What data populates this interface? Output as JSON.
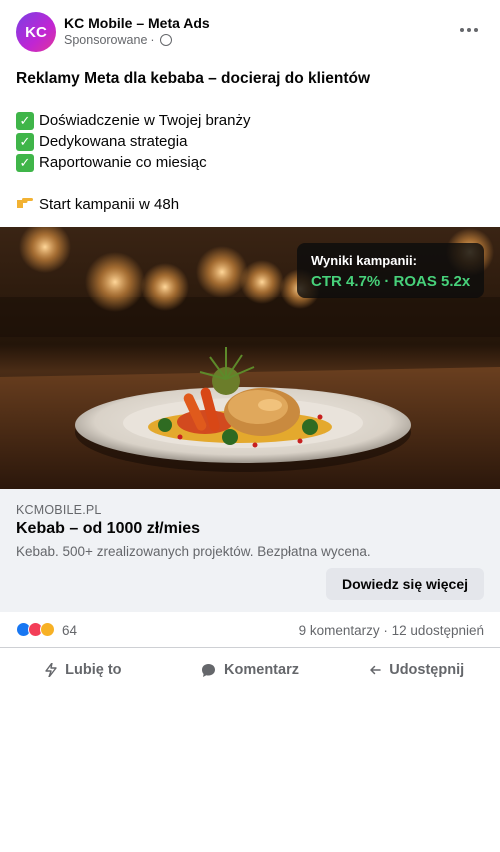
{
  "post": {
    "avatar_initials": "KC",
    "page_name": "KC Mobile – Meta Ads",
    "sponsored_label": "Sponsorowane",
    "separator": "·",
    "headline": "Reklamy Meta dla kebaba – docieraj do klientów",
    "bullets": [
      "Doświadczenie w Twojej branży",
      "Dedykowana strategia",
      "Raportowanie co miesiąc"
    ],
    "check_glyph": "✓",
    "cta_line": "Start kampanii w 48h"
  },
  "image": {
    "stats_title": "Wyniki kampanii:",
    "stats_values": "CTR 4.7% · ROAS 5.2x"
  },
  "link": {
    "domain": "KCMOBILE.PL",
    "title": "Kebab – od 1000 zł/mies",
    "description": "Kebab. 500+ zrealizowanych projektów. Bezpłatna wycena.",
    "button_label": "Dowiedz się więcej"
  },
  "reactions": {
    "count": "64",
    "engagement": "9 komentarzy · 12 udostępnień"
  },
  "actions": {
    "like": "Lubię to",
    "comment": "Komentarz",
    "share": "Udostępnij"
  },
  "colors": {
    "accent_green": "#47d17a",
    "check_green": "#3fb549",
    "muted_text": "#65676b"
  }
}
